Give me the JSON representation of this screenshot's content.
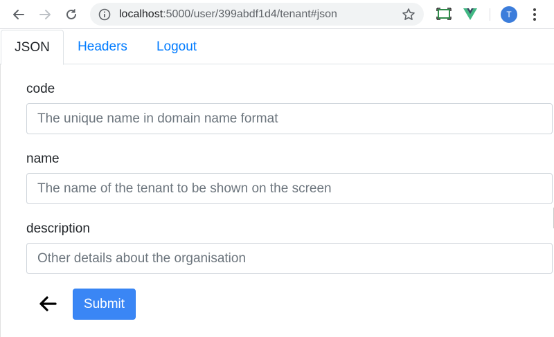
{
  "browser": {
    "url_host": "localhost",
    "url_path": ":5000/user/399abdf1d4/tenant#json",
    "avatar_letter": "T",
    "icons": [
      "back-arrow-icon",
      "forward-arrow-icon",
      "reload-icon",
      "info-icon",
      "star-icon",
      "screencast-icon",
      "vue-devtools-icon",
      "kebab-menu-icon"
    ]
  },
  "tabs": [
    {
      "label": "JSON",
      "active": true
    },
    {
      "label": "Headers",
      "active": false
    },
    {
      "label": "Logout",
      "active": false
    }
  ],
  "form": {
    "code": {
      "label": "code",
      "placeholder": "The unique name in domain name format",
      "value": ""
    },
    "name": {
      "label": "name",
      "placeholder": "The name of the tenant to be shown on the screen",
      "value": ""
    },
    "description": {
      "label": "description",
      "placeholder": "Other details about the organisation",
      "value": ""
    },
    "submit_label": "Submit",
    "back_icon": "arrow-left-icon"
  },
  "colors": {
    "link": "#007bff",
    "primary_button": "#3a86f5",
    "avatar": "#3c7ddb",
    "vue_green": "#41b883"
  }
}
